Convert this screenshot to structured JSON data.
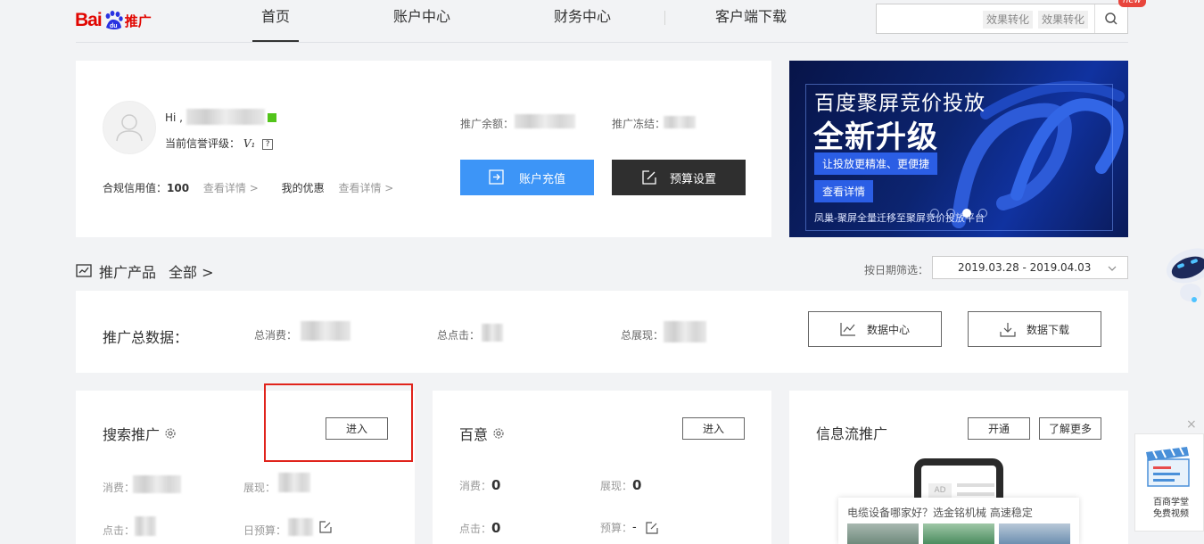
{
  "header": {
    "logo_text": "Bai",
    "logo_du": "du",
    "logo_suffix": "推广",
    "nav": [
      "首页",
      "账户中心",
      "财务中心",
      "客户端下载"
    ],
    "search_tags": [
      "效果转化",
      "效果转化"
    ],
    "new_badge": "new"
  },
  "account": {
    "greeting": "Hi ,",
    "credit_label": "当前信誉评级：",
    "credit_level": "V₁",
    "help": "?",
    "compliance_label": "合规信用值：",
    "compliance_value": "100",
    "detail_link": "查看详情 >",
    "coupon_label": "我的优惠",
    "coupon_link": "查看详情 >",
    "balance_label": "推广余额：",
    "frozen_label": "推广冻结：",
    "recharge_button": "账户充值",
    "budget_button": "预算设置"
  },
  "banner": {
    "line1": "百度聚屏竞价投放",
    "line2": "全新升级",
    "line3": "让投放更精准、更便捷",
    "cta": "查看详情",
    "footer": "凤巢-聚屏全量迁移至聚屏竞价投放平台",
    "dots": 4,
    "active_dot": 2
  },
  "products": {
    "title": "推广产品",
    "all_link": "全部 >",
    "date_label": "按日期筛选：",
    "date_range": "2019.03.28 - 2019.04.03"
  },
  "summary": {
    "title": "推广总数据：",
    "spend_label": "总消费：",
    "click_label": "总点击：",
    "impr_label": "总展现：",
    "data_center": "数据中心",
    "data_download": "数据下载"
  },
  "search_card": {
    "title": "搜索推广",
    "enter": "进入",
    "spend_label": "消费：",
    "impr_label": "展现：",
    "click_label": "点击：",
    "budget_label": "日预算："
  },
  "baiyi_card": {
    "title": "百意",
    "enter": "进入",
    "spend_label": "消费：",
    "spend_value": "0",
    "impr_label": "展现：",
    "impr_value": "0",
    "click_label": "点击：",
    "click_value": "0",
    "budget_label": "预算：",
    "budget_value": "-"
  },
  "feed_card": {
    "title": "信息流推广",
    "open": "开通",
    "learn_more": "了解更多",
    "ad_label": "AD"
  },
  "ad_popup": {
    "text": "电缆设备哪家好？选金铭机械 高速稳定"
  },
  "promo": {
    "line1": "百商学堂",
    "line2": "免费视频",
    "close": "×"
  }
}
